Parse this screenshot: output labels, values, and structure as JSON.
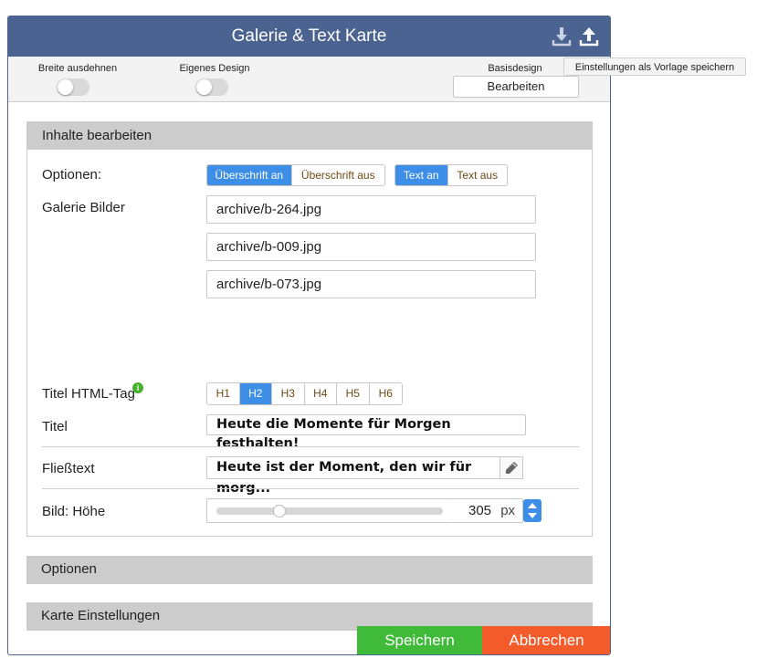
{
  "dialog": {
    "title": "Galerie & Text Karte",
    "icons": [
      "download-icon",
      "upload-icon"
    ]
  },
  "toolbar": {
    "expand_width_label": "Breite ausdehnen",
    "expand_width_on": false,
    "own_design_label": "Eigenes Design",
    "own_design_on": false,
    "base_design_label": "Basisdesign",
    "base_design_button": "Bearbeiten"
  },
  "tooltip": "Einstellungen als Vorlage speichern",
  "content_section": {
    "title": "Inhalte bearbeiten",
    "options_label": "Optionen:",
    "heading_toggle": [
      {
        "label": "Überschrift an",
        "active": true
      },
      {
        "label": "Überschrift aus",
        "active": false
      }
    ],
    "text_toggle": [
      {
        "label": "Text an",
        "active": true
      },
      {
        "label": "Text aus",
        "active": false
      }
    ],
    "gallery_label": "Galerie Bilder",
    "gallery_images": [
      "archive/b-264.jpg",
      "archive/b-009.jpg",
      "archive/b-073.jpg"
    ],
    "title_tag_label": "Titel HTML-Tag",
    "title_tags": [
      {
        "label": "H1",
        "active": false
      },
      {
        "label": "H2",
        "active": true
      },
      {
        "label": "H3",
        "active": false
      },
      {
        "label": "H4",
        "active": false
      },
      {
        "label": "H5",
        "active": false
      },
      {
        "label": "H6",
        "active": false
      }
    ],
    "title_label": "Titel",
    "title_value": "Heute die Momente für Morgen festhalten!",
    "body_label": "Fließtext",
    "body_value": "Heute ist der Moment, den wir für morg...",
    "image_height_label": "Bild: Höhe",
    "image_height_value": "305",
    "image_height_unit": "px",
    "image_height_slider_fraction": 0.28
  },
  "options_section": {
    "title": "Optionen"
  },
  "card_settings_section": {
    "title": "Karte Einstellungen"
  },
  "footer": {
    "save_label": "Speichern",
    "cancel_label": "Abbrechen"
  },
  "colors": {
    "header": "#4b6391",
    "accent": "#3d8ee6",
    "save": "#3fba39",
    "cancel": "#f45b2a",
    "info_badge": "#45b12f"
  }
}
